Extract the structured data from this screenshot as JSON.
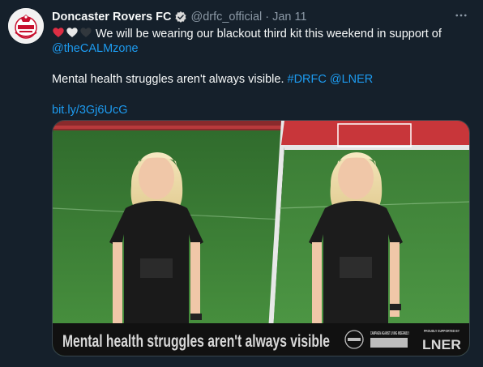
{
  "tweet": {
    "display_name": "Doncaster Rovers FC",
    "handle": "@drfc_official",
    "separator": "·",
    "date": "Jan 11",
    "line1_text": "We will be wearing our blackout third kit this weekend in support of",
    "mention": "@theCALMzone",
    "line3_text": "Mental health struggles aren't always visible.",
    "hashtag": "#DRFC",
    "mention2": "@LNER",
    "short_link": "bit.ly/3Gj6UcG"
  },
  "icons": {
    "verified": "verified-badge-icon",
    "more": "more-options-icon",
    "hearts": [
      "red-heart",
      "white-heart",
      "black-heart"
    ]
  },
  "media": {
    "banner_text": "Mental health struggles aren't always visible",
    "campaign_text": "CAMPAIGN AGAINST LIVING MISERABLY",
    "sponsor_label": "PROUDLY SUPPORTED BY",
    "sponsor_name": "LNER"
  },
  "colors": {
    "background": "#15202b",
    "link": "#1d9bf0",
    "muted": "#8b98a5",
    "pitch": "#3f8a3a",
    "seats": "#c8363a"
  }
}
